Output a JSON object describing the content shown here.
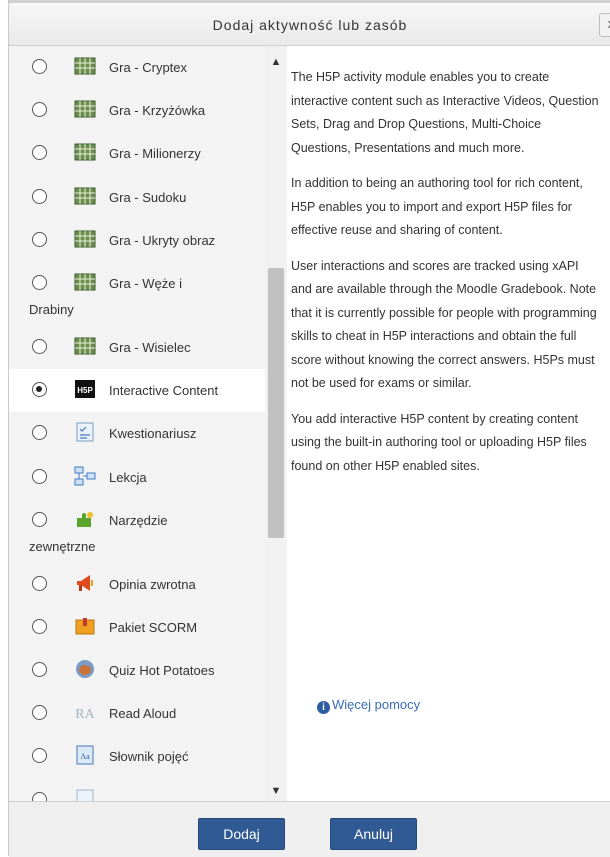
{
  "dialog": {
    "title": "Dodaj aktywność lub zasób",
    "close_label": "x"
  },
  "items": [
    {
      "label": "Gra - Cryptex",
      "icon": "game-grid-icon",
      "selected": false
    },
    {
      "label": "Gra - Krzyżówka",
      "icon": "game-grid-icon",
      "selected": false
    },
    {
      "label": "Gra - Milionerzy",
      "icon": "game-grid-icon",
      "selected": false
    },
    {
      "label": "Gra - Sudoku",
      "icon": "game-grid-icon",
      "selected": false
    },
    {
      "label": "Gra - Ukryty obraz",
      "icon": "game-grid-icon",
      "selected": false
    },
    {
      "label": "Gra - Węże i",
      "label2": "Drabiny",
      "icon": "game-grid-icon",
      "selected": false
    },
    {
      "label": "Gra - Wisielec",
      "icon": "game-grid-icon",
      "selected": false
    },
    {
      "label": "Interactive Content",
      "icon": "h5p-icon",
      "selected": true
    },
    {
      "label": "Kwestionariusz",
      "icon": "questionnaire-icon",
      "selected": false
    },
    {
      "label": "Lekcja",
      "icon": "lesson-icon",
      "selected": false
    },
    {
      "label": "Narzędzie",
      "label2": "zewnętrzne",
      "icon": "puzzle-icon",
      "selected": false
    },
    {
      "label": "Opinia zwrotna",
      "icon": "megaphone-icon",
      "selected": false
    },
    {
      "label": "Pakiet SCORM",
      "icon": "scorm-package-icon",
      "selected": false
    },
    {
      "label": "Quiz Hot Potatoes",
      "icon": "hot-potatoes-icon",
      "selected": false
    },
    {
      "label": "Read Aloud",
      "icon": "read-aloud-icon",
      "selected": false
    },
    {
      "label": "Słownik pojęć",
      "icon": "glossary-icon",
      "selected": false
    }
  ],
  "description": {
    "p1": "The H5P activity module enables you to create interactive content such as Interactive Videos, Question Sets, Drag and Drop Questions, Multi-Choice Questions, Presentations and much more.",
    "p2": "In addition to being an authoring tool for rich content, H5P enables you to import and export H5P files for effective reuse and sharing of content.",
    "p3": "User interactions and scores are tracked using xAPI and are available through the Moodle Gradebook. Note that it is currently possible for people with programming skills to cheat in H5P interactions and obtain the full score without knowing the correct answers. H5Ps must not be used for exams or similar.",
    "p4": "You add interactive H5P content by creating content using the built-in authoring tool or uploading H5P files found on other H5P enabled sites.",
    "help_link": "Więcej pomocy"
  },
  "footer": {
    "add_label": "Dodaj",
    "cancel_label": "Anuluj"
  },
  "colors": {
    "button": "#2f5a93",
    "link": "#3a6cb0"
  }
}
